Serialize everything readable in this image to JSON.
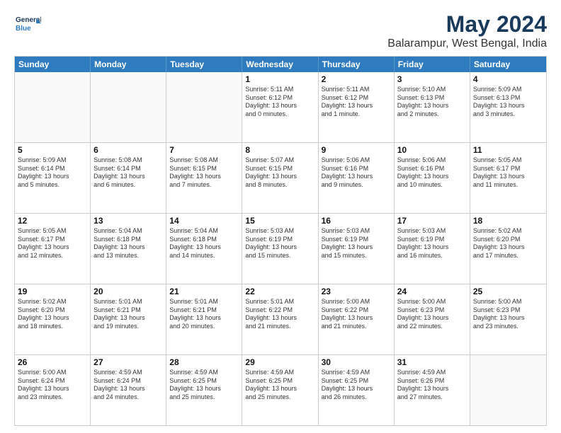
{
  "logo": {
    "line1": "General",
    "line2": "Blue"
  },
  "header": {
    "title": "May 2024",
    "subtitle": "Balarampur, West Bengal, India"
  },
  "weekdays": [
    "Sunday",
    "Monday",
    "Tuesday",
    "Wednesday",
    "Thursday",
    "Friday",
    "Saturday"
  ],
  "weeks": [
    [
      {
        "day": "",
        "text": ""
      },
      {
        "day": "",
        "text": ""
      },
      {
        "day": "",
        "text": ""
      },
      {
        "day": "1",
        "text": "Sunrise: 5:11 AM\nSunset: 6:12 PM\nDaylight: 13 hours\nand 0 minutes."
      },
      {
        "day": "2",
        "text": "Sunrise: 5:11 AM\nSunset: 6:12 PM\nDaylight: 13 hours\nand 1 minute."
      },
      {
        "day": "3",
        "text": "Sunrise: 5:10 AM\nSunset: 6:13 PM\nDaylight: 13 hours\nand 2 minutes."
      },
      {
        "day": "4",
        "text": "Sunrise: 5:09 AM\nSunset: 6:13 PM\nDaylight: 13 hours\nand 3 minutes."
      }
    ],
    [
      {
        "day": "5",
        "text": "Sunrise: 5:09 AM\nSunset: 6:14 PM\nDaylight: 13 hours\nand 5 minutes."
      },
      {
        "day": "6",
        "text": "Sunrise: 5:08 AM\nSunset: 6:14 PM\nDaylight: 13 hours\nand 6 minutes."
      },
      {
        "day": "7",
        "text": "Sunrise: 5:08 AM\nSunset: 6:15 PM\nDaylight: 13 hours\nand 7 minutes."
      },
      {
        "day": "8",
        "text": "Sunrise: 5:07 AM\nSunset: 6:15 PM\nDaylight: 13 hours\nand 8 minutes."
      },
      {
        "day": "9",
        "text": "Sunrise: 5:06 AM\nSunset: 6:16 PM\nDaylight: 13 hours\nand 9 minutes."
      },
      {
        "day": "10",
        "text": "Sunrise: 5:06 AM\nSunset: 6:16 PM\nDaylight: 13 hours\nand 10 minutes."
      },
      {
        "day": "11",
        "text": "Sunrise: 5:05 AM\nSunset: 6:17 PM\nDaylight: 13 hours\nand 11 minutes."
      }
    ],
    [
      {
        "day": "12",
        "text": "Sunrise: 5:05 AM\nSunset: 6:17 PM\nDaylight: 13 hours\nand 12 minutes."
      },
      {
        "day": "13",
        "text": "Sunrise: 5:04 AM\nSunset: 6:18 PM\nDaylight: 13 hours\nand 13 minutes."
      },
      {
        "day": "14",
        "text": "Sunrise: 5:04 AM\nSunset: 6:18 PM\nDaylight: 13 hours\nand 14 minutes."
      },
      {
        "day": "15",
        "text": "Sunrise: 5:03 AM\nSunset: 6:19 PM\nDaylight: 13 hours\nand 15 minutes."
      },
      {
        "day": "16",
        "text": "Sunrise: 5:03 AM\nSunset: 6:19 PM\nDaylight: 13 hours\nand 15 minutes."
      },
      {
        "day": "17",
        "text": "Sunrise: 5:03 AM\nSunset: 6:19 PM\nDaylight: 13 hours\nand 16 minutes."
      },
      {
        "day": "18",
        "text": "Sunrise: 5:02 AM\nSunset: 6:20 PM\nDaylight: 13 hours\nand 17 minutes."
      }
    ],
    [
      {
        "day": "19",
        "text": "Sunrise: 5:02 AM\nSunset: 6:20 PM\nDaylight: 13 hours\nand 18 minutes."
      },
      {
        "day": "20",
        "text": "Sunrise: 5:01 AM\nSunset: 6:21 PM\nDaylight: 13 hours\nand 19 minutes."
      },
      {
        "day": "21",
        "text": "Sunrise: 5:01 AM\nSunset: 6:21 PM\nDaylight: 13 hours\nand 20 minutes."
      },
      {
        "day": "22",
        "text": "Sunrise: 5:01 AM\nSunset: 6:22 PM\nDaylight: 13 hours\nand 21 minutes."
      },
      {
        "day": "23",
        "text": "Sunrise: 5:00 AM\nSunset: 6:22 PM\nDaylight: 13 hours\nand 21 minutes."
      },
      {
        "day": "24",
        "text": "Sunrise: 5:00 AM\nSunset: 6:23 PM\nDaylight: 13 hours\nand 22 minutes."
      },
      {
        "day": "25",
        "text": "Sunrise: 5:00 AM\nSunset: 6:23 PM\nDaylight: 13 hours\nand 23 minutes."
      }
    ],
    [
      {
        "day": "26",
        "text": "Sunrise: 5:00 AM\nSunset: 6:24 PM\nDaylight: 13 hours\nand 23 minutes."
      },
      {
        "day": "27",
        "text": "Sunrise: 4:59 AM\nSunset: 6:24 PM\nDaylight: 13 hours\nand 24 minutes."
      },
      {
        "day": "28",
        "text": "Sunrise: 4:59 AM\nSunset: 6:25 PM\nDaylight: 13 hours\nand 25 minutes."
      },
      {
        "day": "29",
        "text": "Sunrise: 4:59 AM\nSunset: 6:25 PM\nDaylight: 13 hours\nand 25 minutes."
      },
      {
        "day": "30",
        "text": "Sunrise: 4:59 AM\nSunset: 6:25 PM\nDaylight: 13 hours\nand 26 minutes."
      },
      {
        "day": "31",
        "text": "Sunrise: 4:59 AM\nSunset: 6:26 PM\nDaylight: 13 hours\nand 27 minutes."
      },
      {
        "day": "",
        "text": ""
      }
    ]
  ]
}
